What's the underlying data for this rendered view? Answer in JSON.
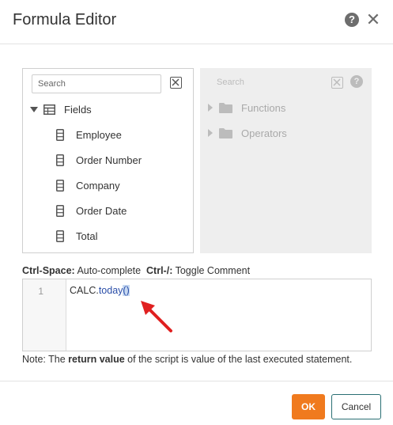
{
  "dialog": {
    "title": "Formula Editor",
    "help_glyph": "?",
    "close_glyph": "✕"
  },
  "fields_panel": {
    "search_placeholder": "Search",
    "root_label": "Fields",
    "items": [
      {
        "label": "Employee"
      },
      {
        "label": "Order Number"
      },
      {
        "label": "Company"
      },
      {
        "label": "Order Date"
      },
      {
        "label": "Total"
      }
    ]
  },
  "functions_panel": {
    "search_placeholder": "Search",
    "help_glyph": "?",
    "items": [
      {
        "label": "Functions"
      },
      {
        "label": "Operators"
      }
    ]
  },
  "shortcuts": {
    "key1": "Ctrl-Space:",
    "desc1": " Auto-complete",
    "key2": "Ctrl-/:",
    "desc2": " Toggle Comment"
  },
  "editor": {
    "line_number": "1",
    "code_object": "CALC.",
    "code_function": "today",
    "code_parens": "()"
  },
  "note": {
    "prefix": "Note: The ",
    "emphasis": "return value",
    "suffix": " of the script is value of the last executed statement."
  },
  "buttons": {
    "ok_label": "OK",
    "cancel_label": "Cancel"
  },
  "colors": {
    "accent_orange": "#f07a1e",
    "arrow_red": "#e02020",
    "code_function": "#2a4ea8"
  }
}
